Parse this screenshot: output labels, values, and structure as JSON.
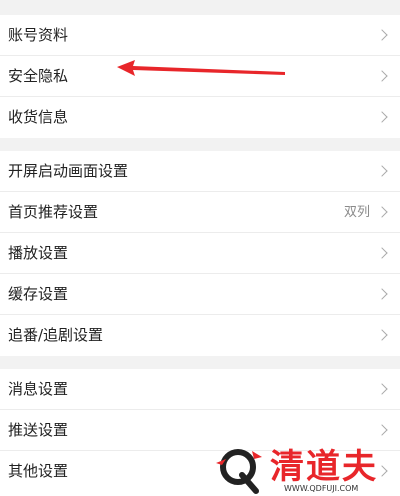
{
  "groups": [
    {
      "items": [
        {
          "label": "账号资料"
        },
        {
          "label": "安全隐私"
        },
        {
          "label": "收货信息"
        }
      ]
    },
    {
      "items": [
        {
          "label": "开屏启动画面设置"
        },
        {
          "label": "首页推荐设置",
          "value": "双列"
        },
        {
          "label": "播放设置"
        },
        {
          "label": "缓存设置"
        },
        {
          "label": "追番/追剧设置"
        }
      ]
    },
    {
      "items": [
        {
          "label": "消息设置"
        },
        {
          "label": "推送设置"
        },
        {
          "label": "其他设置"
        }
      ]
    }
  ],
  "annotation": {
    "arrow_color": "#e8262a",
    "icon": "red-arrow-pointer"
  },
  "watermark": {
    "brand": "清道夫",
    "url": "WWW.QDFUJI.COM",
    "color": "#e8262a",
    "icon": "q-logo"
  }
}
